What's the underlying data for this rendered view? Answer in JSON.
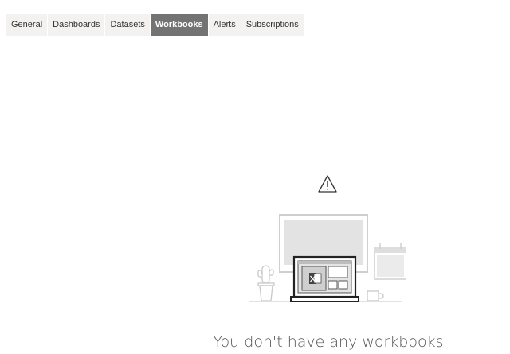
{
  "tabs": [
    {
      "label": "General",
      "active": false
    },
    {
      "label": "Dashboards",
      "active": false
    },
    {
      "label": "Datasets",
      "active": false
    },
    {
      "label": "Workbooks",
      "active": true
    },
    {
      "label": "Alerts",
      "active": false
    },
    {
      "label": "Subscriptions",
      "active": false
    }
  ],
  "empty_state": {
    "icon": "warning-icon",
    "illustration": "workspace-illustration",
    "message": "You don't have any workbooks"
  },
  "colors": {
    "tab_bg": "#f3f2f1",
    "tab_active_bg": "#737373",
    "illustration_stroke": "#c8c8c8",
    "illustration_dark": "#333333"
  }
}
